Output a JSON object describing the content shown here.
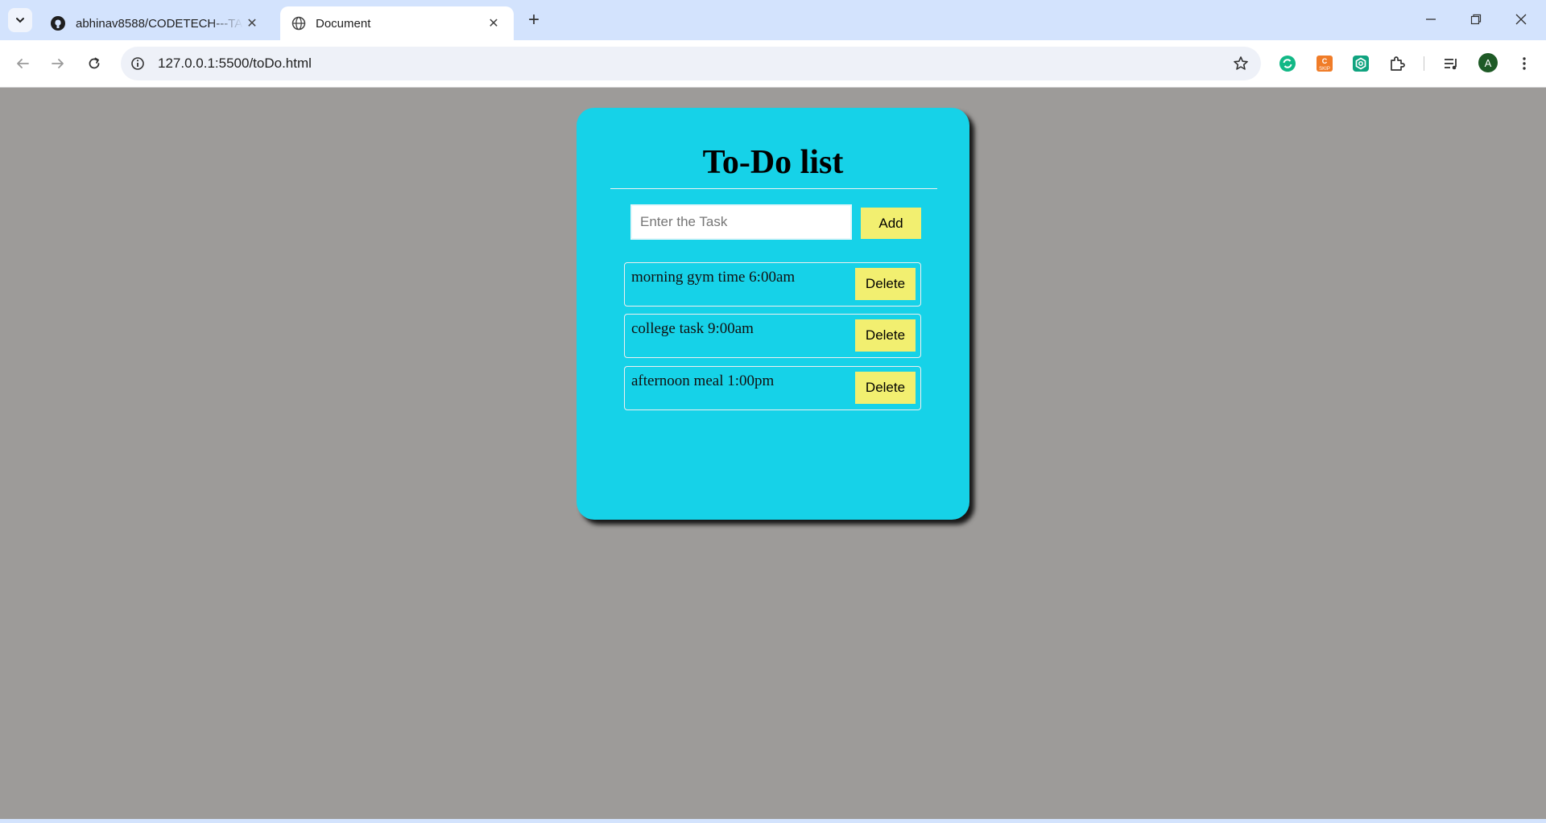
{
  "browser": {
    "tabs": [
      {
        "title": "abhinav8588/CODETECH---TASK",
        "favicon": "github-icon",
        "active": false
      },
      {
        "title": "Document",
        "favicon": "globe-icon",
        "active": true
      }
    ],
    "url": "127.0.0.1:5500/toDo.html",
    "profile_initial": "A",
    "extensions": [
      "sync-extension-icon",
      "skip-extension-icon",
      "hexagon-extension-icon",
      "puzzle-extensions-icon",
      "media-queue-icon"
    ]
  },
  "colors": {
    "page_background": "#9d9b99",
    "card_background": "#16d2e8",
    "button_background": "#f2ef70"
  },
  "app": {
    "title": "To-Do list",
    "input_placeholder": "Enter the Task",
    "input_value": "",
    "add_label": "Add",
    "tasks": [
      {
        "text": "morning gym time 6:00am",
        "delete_label": "Delete"
      },
      {
        "text": "college task 9:00am",
        "delete_label": "Delete"
      },
      {
        "text": "afternoon meal 1:00pm",
        "delete_label": "Delete"
      }
    ]
  }
}
